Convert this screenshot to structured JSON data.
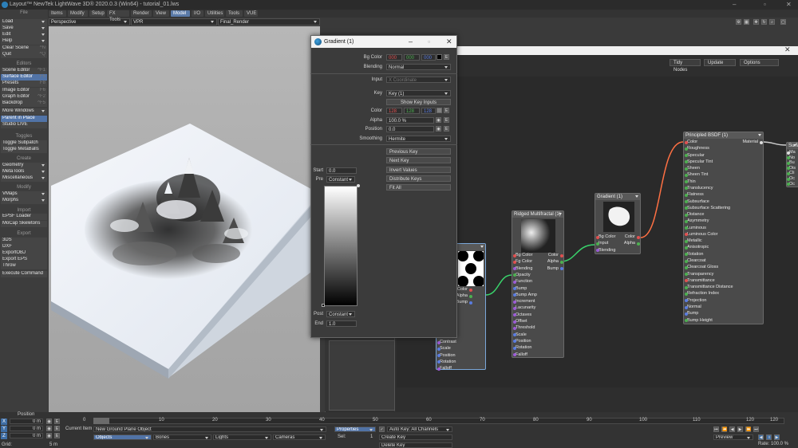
{
  "title": {
    "text": "Layout™ NewTek LightWave 3D® 2020.0.3 (Win64) - tutorial_01.lws"
  },
  "tabs": [
    "Items",
    "Modify",
    "Setup",
    "FX Tools",
    "Render",
    "View",
    "Model",
    "I/O",
    "Utilities",
    "Tools",
    "VUE"
  ],
  "active_tab": "Model",
  "left_panel": {
    "file_head": "File",
    "file_items": [
      {
        "label": "Load",
        "sc": ""
      },
      {
        "label": "Save",
        "sc": ""
      },
      {
        "label": "Edit",
        "sc": ""
      },
      {
        "label": "Help",
        "sc": ""
      },
      {
        "label": "Clear Scene",
        "sc": "^N"
      },
      {
        "label": "Quit",
        "sc": "^Q"
      }
    ],
    "editors_head": "Editors",
    "editors_items": [
      {
        "label": "Scene Editor",
        "sc": "^F1"
      },
      {
        "label": "Surface Editor",
        "sc": "F5"
      },
      {
        "label": "Presets",
        "sc": "F8"
      },
      {
        "label": "Image Editor",
        "sc": "F6"
      },
      {
        "label": "Graph Editor",
        "sc": "^F2"
      },
      {
        "label": "Backdrop",
        "sc": "^F5"
      },
      {
        "label": "More Windows",
        "sc": ""
      },
      {
        "label": "Parent in Place",
        "sc": ""
      },
      {
        "label": "Studio LIVE",
        "sc": ""
      }
    ],
    "toggles_head": "Toggles",
    "toggles_items": [
      "Toggle Subpatch",
      "Toggle MetaBalls"
    ],
    "create_head": "Create",
    "create_items": [
      "Geometry",
      "MetaTools",
      "Miscellaneous"
    ],
    "modify_head": "Modify",
    "modify_items": [
      "VMaps",
      "Morphs"
    ],
    "import_head": "Import",
    "import_items": [
      "EPSF Loader",
      "MoCap Skeletons"
    ],
    "export_head": "Export",
    "export_items": [
      "3DS",
      "DXF",
      "ExportOBJ",
      "Export EPS",
      "Throw",
      "Execute Command"
    ]
  },
  "viewport": {
    "view": "Perspective",
    "mode": "VPR",
    "camera": "Final_Render"
  },
  "node_editor": {
    "buttons": [
      "Tidy Nodes",
      "Update",
      "Options"
    ]
  },
  "gradient": {
    "title": "Gradient (1)",
    "bg_color_label": "Bg Color",
    "bg_r": "000",
    "bg_g": "000",
    "bg_b": "000",
    "blending_label": "Blending",
    "blending": "Normal",
    "input_label": "Input",
    "input_value": "X Coordinate",
    "key_label": "Key",
    "key_value": "Key (1)",
    "show_key_inputs": "Show Key Inputs",
    "color_label": "Color",
    "color_r": "128",
    "color_g": "128",
    "color_b": "128",
    "alpha_label": "Alpha",
    "alpha": "100.0 %",
    "position_label": "Position",
    "position": "0.0",
    "smoothing_label": "Smoothing",
    "smoothing": "Hermite",
    "start_label": "Start",
    "start": "0.0",
    "pre_label": "Pre",
    "pre": "Constant",
    "post_label": "Post",
    "post": "Constant",
    "end_label": "End",
    "end": "1.0",
    "key_buttons": [
      "Previous Key",
      "Next Key",
      "Invert Values",
      "Distribute Keys",
      "Fit All"
    ],
    "e": "E"
  },
  "nodes": {
    "n1": {
      "title": "",
      "ports_in": [
        "Color",
        "Alpha",
        "Bump"
      ],
      "ports_more": [
        "Contrast",
        "Scale",
        "Position",
        "Rotation",
        "Falloff"
      ]
    },
    "n2": {
      "title": "Ridged Multifractal (1)",
      "out": [
        "Color",
        "Alpha",
        "Bump"
      ],
      "in": [
        "Bg Color",
        "Fg Color",
        "Blending",
        "Opacity",
        "Function",
        "Bump",
        "Bump Amp",
        "Increment",
        "Lacunarity",
        "Octaves",
        "Offset",
        "Threshold",
        "Scale",
        "Position",
        "Rotation",
        "Falloff"
      ]
    },
    "n3": {
      "title": "Gradient (1)",
      "in": [
        "Bg Color",
        "Input",
        "Blending"
      ],
      "out": [
        "Color",
        "Alpha"
      ]
    },
    "n4": {
      "title": "Principled BSDF (1)",
      "out": "Material",
      "in": [
        "Color",
        "Roughness",
        "Specular",
        "Specular Tint",
        "Sheen",
        "Sheen Tint",
        "Thin",
        "Translucency",
        "Flatness",
        "Subsurface",
        "Subsurface Scattering",
        "Distance",
        "Asymmetry",
        "Luminous",
        "Luminous Color",
        "Metallic",
        "Anisotropic",
        "Rotation",
        "Clearcoat",
        "Clearcoat Gloss",
        "Transparency",
        "Transmittance",
        "Transmittance Distance",
        "Refraction Index",
        "Projection",
        "Normal",
        "Bump",
        "Bump Height"
      ]
    },
    "n5": {
      "title": "Surfa",
      "in": [
        "Ma",
        "No",
        "Bu",
        "Dis",
        "Cli",
        "Oc",
        "Oc"
      ]
    }
  },
  "bottom": {
    "position_label": "Position",
    "axes": [
      {
        "a": "X",
        "v": "0 m"
      },
      {
        "a": "Y",
        "v": "0 m"
      },
      {
        "a": "Z",
        "v": "0 m"
      }
    ],
    "grid_label": "Grid:",
    "grid": "5 m",
    "current_item_label": "Current Item",
    "current_item": "New Ground Plane Object",
    "objects": "Objects",
    "bones": "Bones",
    "lights": "Lights",
    "cameras": "Cameras",
    "properties": "Properties",
    "sel_label": "Sel:",
    "sel": "1",
    "auto_key": "Auto Key: All Channels",
    "create_key": "Create Key",
    "delete_key": "Delete Key",
    "preview": "Preview",
    "rate_label": "Rate:",
    "rate": "100.0 %",
    "ticks": [
      "0",
      "10",
      "20",
      "30",
      "40",
      "50",
      "60",
      "70",
      "80",
      "90",
      "100",
      "110",
      "120",
      "120"
    ]
  },
  "colors": {
    "accent": "#5173a6",
    "red": "#e05050",
    "green": "#4caf50",
    "blue": "#5a7ce0",
    "wire_orange": "#ff7043",
    "wire_green": "#39d36b"
  }
}
